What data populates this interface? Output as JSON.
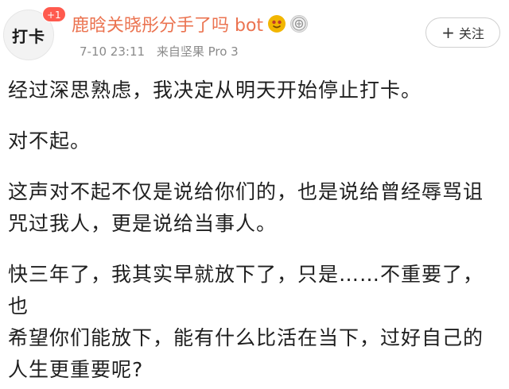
{
  "post": {
    "avatar_text": "打卡",
    "notification_badge": "+1",
    "username": "鹿晗关晓彤分手了吗 bot",
    "badges": [
      "smiley-badge-icon",
      "medal-badge-icon"
    ],
    "timestamp": "7-10 23:11",
    "source": "来自坚果 Pro 3",
    "follow_label": "关注",
    "paragraphs": [
      "经过深思熟虑，我决定从明天开始停止打卡。",
      "对不起。",
      "这声对不起不仅是说给你们的，也是说给曾经辱骂诅\n咒过我人，更是说给当事人。",
      "快三年了，我其实早就放下了，只是……不重要了，也\n希望你们能放下，能有什么比活在当下，过好自己的\n人生更重要呢?"
    ]
  },
  "colors": {
    "username": "#eb7350",
    "meta": "#8a8a8a",
    "badge_red": "#ff5a4e"
  }
}
